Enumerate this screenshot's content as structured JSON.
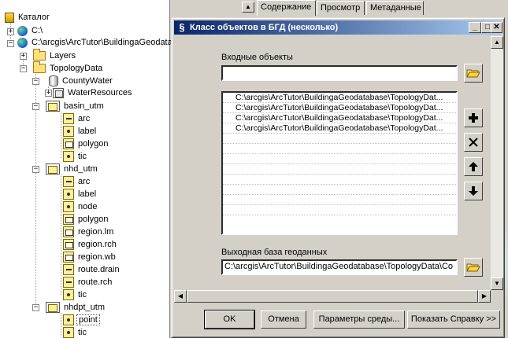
{
  "catalog": {
    "items": [
      {
        "label": "Каталог",
        "icon": "catalog-icon"
      },
      {
        "label": "C:\\",
        "icon": "globe-drive-icon"
      },
      {
        "label": "C:\\arcgis\\ArcTutor\\BuildingaGeodatabase",
        "icon": "globe-drive-icon"
      },
      {
        "label": "Layers",
        "icon": "folder-icon"
      },
      {
        "label": "TopologyData",
        "icon": "folder-icon"
      },
      {
        "label": "CountyWater",
        "icon": "geodatabase-icon"
      },
      {
        "label": "WaterResources",
        "icon": "feature-dataset-icon"
      },
      {
        "label": "basin_utm",
        "icon": "coverage-icon"
      },
      {
        "label": "arc",
        "icon": "line-feature-icon"
      },
      {
        "label": "label",
        "icon": "point-feature-icon"
      },
      {
        "label": "polygon",
        "icon": "polygon-feature-icon"
      },
      {
        "label": "tic",
        "icon": "point-feature-icon"
      },
      {
        "label": "nhd_utm",
        "icon": "coverage-icon"
      },
      {
        "label": "arc",
        "icon": "line-feature-icon"
      },
      {
        "label": "label",
        "icon": "point-feature-icon"
      },
      {
        "label": "node",
        "icon": "point-feature-icon"
      },
      {
        "label": "polygon",
        "icon": "polygon-feature-icon"
      },
      {
        "label": "region.lm",
        "icon": "polygon-feature-icon"
      },
      {
        "label": "region.rch",
        "icon": "polygon-feature-icon"
      },
      {
        "label": "region.wb",
        "icon": "polygon-feature-icon"
      },
      {
        "label": "route.drain",
        "icon": "line-feature-icon"
      },
      {
        "label": "route.rch",
        "icon": "line-feature-icon"
      },
      {
        "label": "tic",
        "icon": "point-feature-icon"
      },
      {
        "label": "nhdpt_utm",
        "icon": "coverage-icon"
      },
      {
        "label": "point",
        "icon": "point-feature-icon"
      },
      {
        "label": "tic",
        "icon": "point-feature-icon"
      }
    ]
  },
  "tabs": [
    "Содержание",
    "Просмотр",
    "Метаданные"
  ],
  "dialog": {
    "title": "Класс объектов в БГД (несколько)",
    "input_label": "Входные объекты",
    "input_value": "",
    "list_rows": [
      "C:\\arcgis\\ArcTutor\\BuildingaGeodatabase\\TopologyDat...",
      "C:\\arcgis\\ArcTutor\\BuildingaGeodatabase\\TopologyDat...",
      "C:\\arcgis\\ArcTutor\\BuildingaGeodatabase\\TopologyDat...",
      "C:\\arcgis\\ArcTutor\\BuildingaGeodatabase\\TopologyDat..."
    ],
    "output_label": "Выходная база геоданных",
    "output_value": "C:\\arcgis\\ArcTutor\\BuildingaGeodatabase\\TopologyData\\Co",
    "buttons": {
      "ok": "OK",
      "cancel": "Отмена",
      "env": "Параметры среды...",
      "help": "Показать Справку >>"
    },
    "title_buttons": {
      "minimize": "_",
      "maximize": "□",
      "close": "✕"
    }
  }
}
